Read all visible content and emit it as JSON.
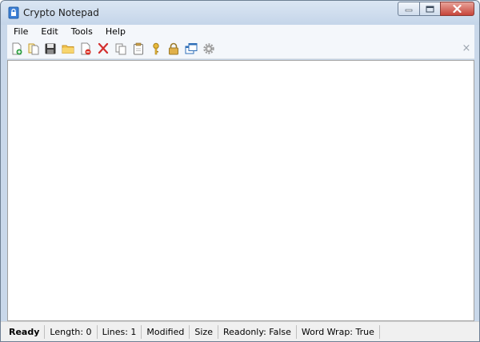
{
  "window": {
    "title": "Crypto Notepad"
  },
  "menubar": {
    "items": [
      {
        "label": "File"
      },
      {
        "label": "Edit"
      },
      {
        "label": "Tools"
      },
      {
        "label": "Help"
      }
    ]
  },
  "toolbar": {
    "buttons": [
      {
        "icon": "new-file-icon"
      },
      {
        "icon": "open-file-icon"
      },
      {
        "icon": "save-icon"
      },
      {
        "icon": "folder-icon"
      },
      {
        "icon": "delete-file-icon"
      },
      {
        "icon": "cut-icon"
      },
      {
        "icon": "copy-icon"
      },
      {
        "icon": "paste-icon"
      },
      {
        "icon": "key-icon"
      },
      {
        "icon": "lock-icon"
      },
      {
        "icon": "always-on-top-icon"
      },
      {
        "icon": "settings-icon"
      }
    ],
    "close_glyph": "×"
  },
  "editor": {
    "content": ""
  },
  "statusbar": {
    "ready": "Ready",
    "length": "Length: 0",
    "lines": "Lines: 1",
    "modified": "Modified",
    "size": "Size",
    "readonly": "Readonly: False",
    "word_wrap": "Word Wrap: True"
  },
  "colors": {
    "title_bar": "#c9d8ea",
    "close_button": "#c7443a",
    "status_bar": "#f0f0f0"
  }
}
